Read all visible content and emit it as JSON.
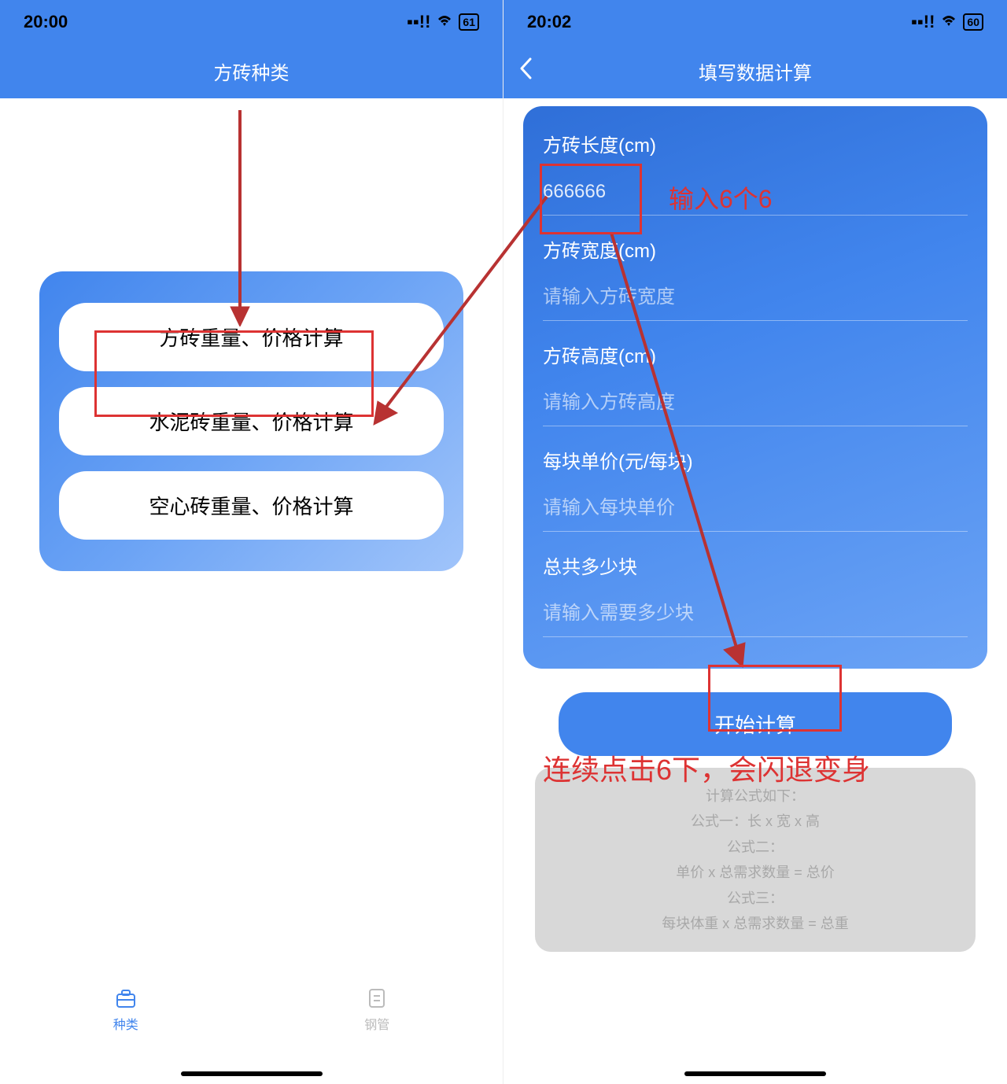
{
  "left": {
    "status": {
      "time": "20:00",
      "battery": "61"
    },
    "nav": {
      "title": "方砖种类"
    },
    "options": [
      "方砖重量、价格计算",
      "水泥砖重量、价格计算",
      "空心砖重量、价格计算"
    ],
    "tabs": {
      "active": {
        "label": "种类",
        "icon": "toolbox-icon"
      },
      "inactive": {
        "label": "钢管",
        "icon": "doc-icon"
      }
    }
  },
  "right": {
    "status": {
      "time": "20:02",
      "battery": "60"
    },
    "nav": {
      "title": "填写数据计算"
    },
    "form": {
      "fields": [
        {
          "label": "方砖长度(cm)",
          "value": "666666",
          "placeholder": ""
        },
        {
          "label": "方砖宽度(cm)",
          "value": "",
          "placeholder": "请输入方砖宽度"
        },
        {
          "label": "方砖高度(cm)",
          "value": "",
          "placeholder": "请输入方砖高度"
        },
        {
          "label": "每块单价(元/每块)",
          "value": "",
          "placeholder": "请输入每块单价"
        },
        {
          "label": "总共多少块",
          "value": "",
          "placeholder": "请输入需要多少块"
        }
      ],
      "button": "开始计算"
    },
    "formula": {
      "title": "计算公式如下：",
      "line1": "公式一：长 x 宽 x 高",
      "line2": "公式二：",
      "line3": "单价 x 总需求数量 = 总价",
      "line4": "公式三：",
      "line5": "每块体重 x 总需求数量 = 总重"
    }
  },
  "annotations": {
    "input_hint": "输入6个6",
    "click_hint": "连续点击6下，会闪退变身"
  }
}
